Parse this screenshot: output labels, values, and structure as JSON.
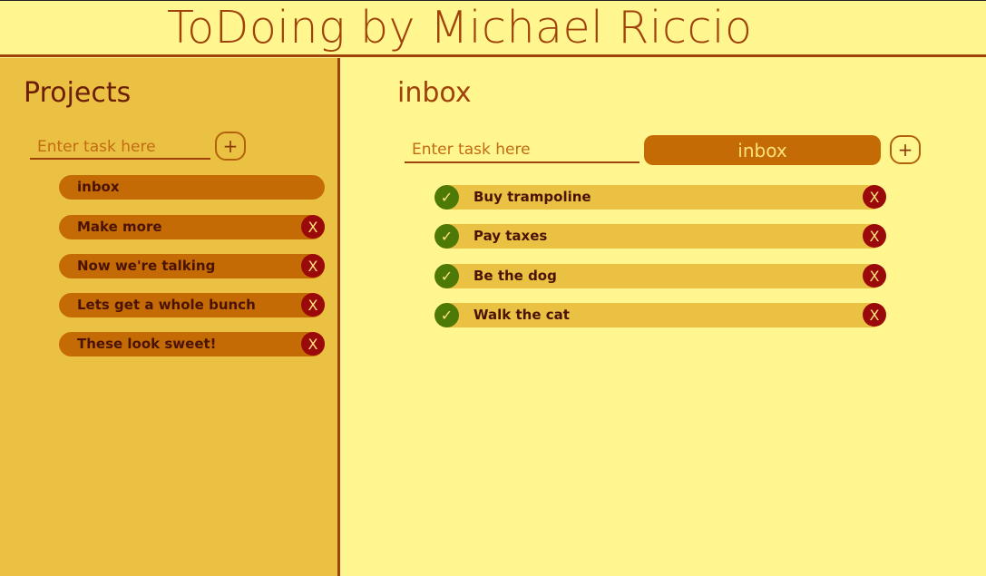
{
  "header": {
    "title": "ToDoing by Michael Riccio"
  },
  "sidebar": {
    "heading": "Projects",
    "input_placeholder": "Enter task here",
    "add_label": "+",
    "projects": [
      {
        "label": "inbox"
      },
      {
        "label": "Make more",
        "delete_label": "X"
      },
      {
        "label": "Now we're talking",
        "delete_label": "X"
      },
      {
        "label": "Lets get a whole bunch",
        "delete_label": "X"
      },
      {
        "label": "These look sweet!",
        "delete_label": "X"
      }
    ]
  },
  "main": {
    "heading": "inbox",
    "input_placeholder": "Enter task here",
    "project_select": "inbox",
    "add_label": "+",
    "tasks": [
      {
        "label": "Buy trampoline",
        "check_label": "✓",
        "delete_label": "X"
      },
      {
        "label": "Pay taxes",
        "check_label": "✓",
        "delete_label": "X"
      },
      {
        "label": "Be the dog",
        "check_label": "✓",
        "delete_label": "X"
      },
      {
        "label": "Walk the cat",
        "check_label": "✓",
        "delete_label": "X"
      }
    ]
  },
  "colors": {
    "background": "#FFF68F",
    "sidebar": "#EBC143",
    "accent": "#A0420B",
    "pill": "#C56B05",
    "delete": "#9B0A0A",
    "complete": "#4D7A07"
  }
}
